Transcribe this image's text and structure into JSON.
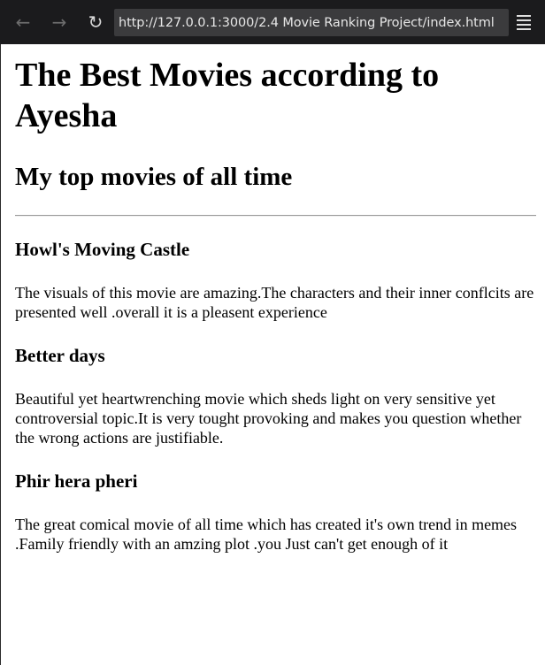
{
  "browser": {
    "back_icon": "arrow-left-icon",
    "forward_icon": "arrow-right-icon",
    "reload_icon": "reload-icon",
    "menu_icon": "hamburger-menu-icon",
    "url": "http://127.0.0.1:3000/2.4 Movie Ranking Project/index.html"
  },
  "page": {
    "title": "The Best Movies according to Ayesha",
    "subtitle": "My top movies of all time",
    "movies": [
      {
        "name": "Howl's Moving Castle",
        "review": "The visuals of this movie are amazing.The characters and their inner conflcits are presented well .overall it is a pleasent experience"
      },
      {
        "name": "Better days",
        "review": "Beautiful yet heartwrenching movie which sheds light on very sensitive yet controversial topic.It is very tought provoking and makes you question whether the wrong actions are justifiable."
      },
      {
        "name": "Phir hera pheri",
        "review": "The great comical movie of all time which has created it's own trend in memes .Family friendly with an amzing plot .you Just can't get enough of it"
      }
    ]
  }
}
